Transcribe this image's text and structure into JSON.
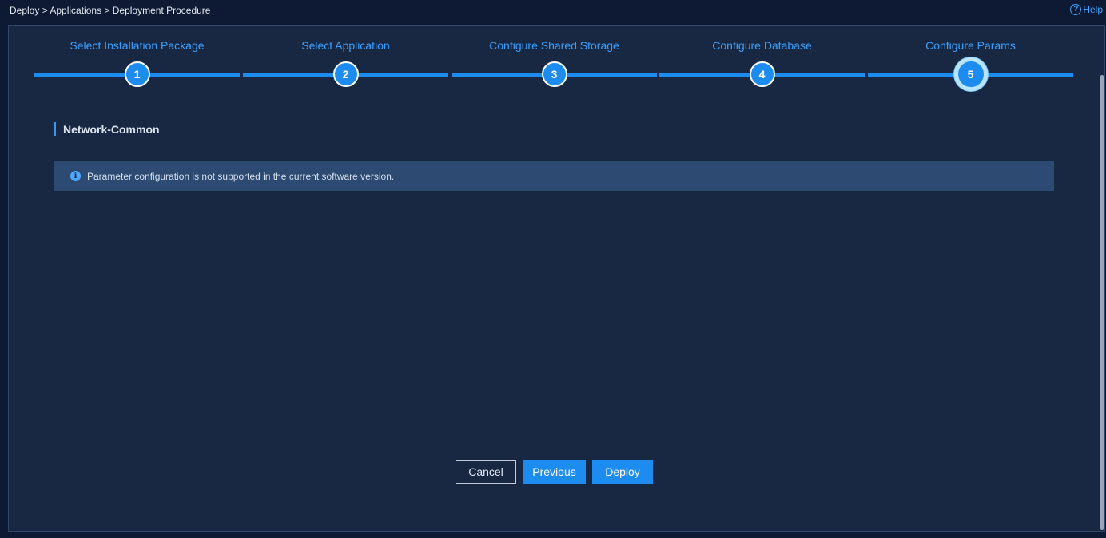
{
  "breadcrumb": "Deploy > Applications > Deployment Procedure",
  "help": {
    "label": "Help",
    "icon": "question-circle-icon"
  },
  "steps": [
    {
      "label": "Select Installation Package",
      "number": "1"
    },
    {
      "label": "Select Application",
      "number": "2"
    },
    {
      "label": "Configure Shared Storage",
      "number": "3"
    },
    {
      "label": "Configure Database",
      "number": "4"
    },
    {
      "label": "Configure Params",
      "number": "5"
    }
  ],
  "active_step": 5,
  "section": {
    "title": "Network-Common"
  },
  "info": {
    "icon": "info-icon",
    "text": "Parameter configuration is not supported in the current software version."
  },
  "buttons": {
    "cancel": "Cancel",
    "previous": "Previous",
    "deploy": "Deploy"
  },
  "colors": {
    "accent": "#1d8cf0",
    "background": "#182843",
    "info_box": "#2c4a72"
  }
}
